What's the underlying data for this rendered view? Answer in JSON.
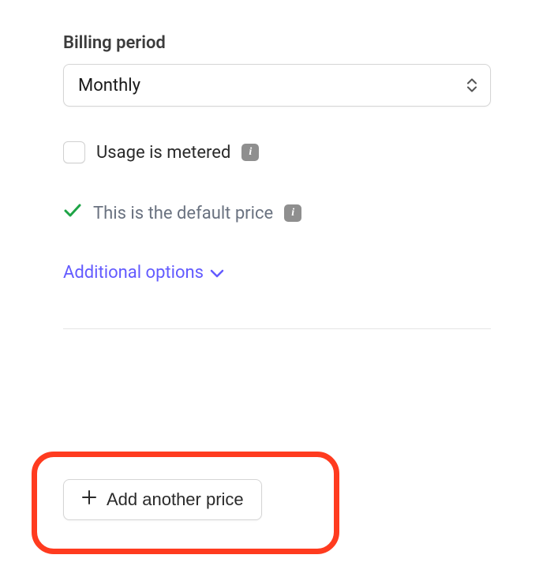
{
  "billing": {
    "label": "Billing period",
    "selected": "Monthly"
  },
  "metered": {
    "label": "Usage is metered"
  },
  "defaultPrice": {
    "label": "This is the default price"
  },
  "additional": {
    "label": "Additional options"
  },
  "addPrice": {
    "label": "Add another price"
  },
  "info": {
    "glyph": "i"
  }
}
